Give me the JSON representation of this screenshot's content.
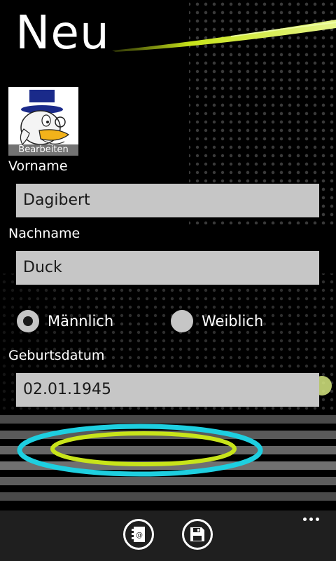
{
  "page": {
    "title": "Neu"
  },
  "avatar": {
    "edit_label": "Bearbeiten"
  },
  "form": {
    "first_name_label": "Vorname",
    "first_name_value": "Dagibert",
    "last_name_label": "Nachname",
    "last_name_value": "Duck",
    "gender_options": [
      {
        "label": "Männlich",
        "selected": true
      },
      {
        "label": "Weiblich",
        "selected": false
      }
    ],
    "birthdate_label": "Geburtsdatum",
    "birthdate_value": "02.01.1945"
  },
  "app_bar": {
    "buttons": [
      {
        "icon": "contact-card-icon"
      },
      {
        "icon": "save-icon"
      }
    ],
    "more_icon": "ellipsis-icon"
  },
  "colors": {
    "background": "#000000",
    "field": "#c6c6c6",
    "accent_lime": "#c8e41a",
    "accent_cyan": "#1ecfe0",
    "appbar": "#1f1f1f"
  }
}
